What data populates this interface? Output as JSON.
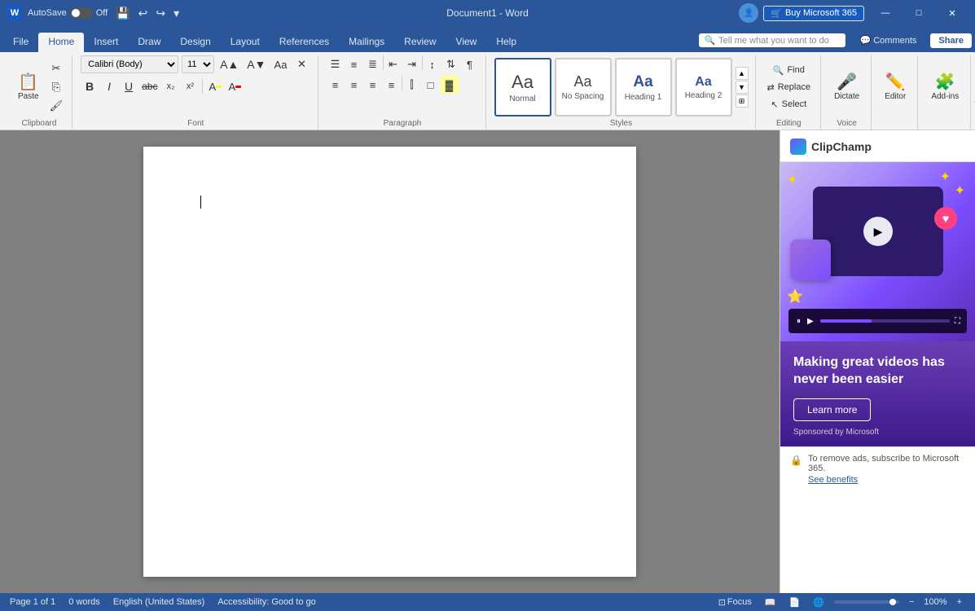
{
  "titlebar": {
    "app_name": "Word",
    "autosave_label": "AutoSave",
    "autosave_state": "Off",
    "doc_title": "Document1 - Word",
    "undo_tooltip": "Undo",
    "redo_tooltip": "Redo",
    "buy_label": "Buy Microsoft 365",
    "win_minimize": "—",
    "win_maximize": "□",
    "win_close": "✕"
  },
  "tabs": [
    {
      "label": "File",
      "active": false
    },
    {
      "label": "Home",
      "active": true
    },
    {
      "label": "Insert",
      "active": false
    },
    {
      "label": "Draw",
      "active": false
    },
    {
      "label": "Design",
      "active": false
    },
    {
      "label": "Layout",
      "active": false
    },
    {
      "label": "References",
      "active": false
    },
    {
      "label": "Mailings",
      "active": false
    },
    {
      "label": "Review",
      "active": false
    },
    {
      "label": "View",
      "active": false
    },
    {
      "label": "Help",
      "active": false
    }
  ],
  "search_placeholder": "Tell me what you want to do",
  "comments_label": "Comments",
  "share_label": "Share",
  "ribbon": {
    "clipboard": {
      "label": "Clipboard",
      "paste_label": "Paste",
      "cut_label": "Cut",
      "copy_label": "Copy",
      "format_painter_label": "Format Painter"
    },
    "font": {
      "label": "Font",
      "family": "Calibri (Body)",
      "size": "11",
      "grow_label": "Increase Font Size",
      "shrink_label": "Decrease Font Size",
      "case_label": "Change Case",
      "clear_label": "Clear Formatting",
      "bold_label": "B",
      "italic_label": "I",
      "underline_label": "U",
      "strikethrough_label": "abc",
      "sub_label": "x₂",
      "sup_label": "x²",
      "highlight_label": "A",
      "color_label": "A"
    },
    "paragraph": {
      "label": "Paragraph",
      "bullets_label": "Bullets",
      "numbering_label": "Numbering",
      "multilevel_label": "Multilevel",
      "outdent_label": "Decrease Indent",
      "indent_label": "Increase Indent",
      "spacing_label": "Line Spacing",
      "sort_label": "Sort",
      "show_label": "Show/Hide",
      "align_left": "Align Left",
      "align_center": "Center",
      "align_right": "Align Right",
      "align_justify": "Justify",
      "columns_label": "Columns",
      "borders_label": "Borders",
      "shading_label": "Shading"
    },
    "styles": {
      "label": "Styles",
      "items": [
        {
          "id": "normal",
          "text": "Aa",
          "label": "Normal",
          "active": true
        },
        {
          "id": "nospacing",
          "text": "Aa",
          "label": "No Spacing",
          "active": false
        },
        {
          "id": "heading1",
          "text": "Aa",
          "label": "Heading 1",
          "active": false
        },
        {
          "id": "heading2",
          "text": "Aa",
          "label": "Heading 2",
          "active": false
        }
      ]
    },
    "editing": {
      "label": "Editing",
      "find_label": "Find",
      "replace_label": "Replace",
      "select_label": "Select"
    },
    "voice": {
      "label": "Voice",
      "dictate_label": "Dictate"
    },
    "editor_label": "Editor",
    "addins_label": "Add-ins"
  },
  "document": {
    "content": "",
    "cursor_visible": true
  },
  "side_panel": {
    "title": "ClipChamp",
    "ad_headline": "Making great videos has never been easier",
    "learn_more_label": "Learn more",
    "sponsored_text": "Sponsored by Microsoft",
    "remove_ads_text": "To remove ads, subscribe to Microsoft 365.",
    "see_benefits_label": "See benefits"
  },
  "statusbar": {
    "page_info": "Page 1 of 1",
    "word_count": "0 words",
    "language": "English (United States)",
    "accessibility": "Accessibility: Good to go",
    "focus_label": "Focus",
    "read_label": "Read",
    "print_label": "Print",
    "zoom_pct": "100%"
  }
}
